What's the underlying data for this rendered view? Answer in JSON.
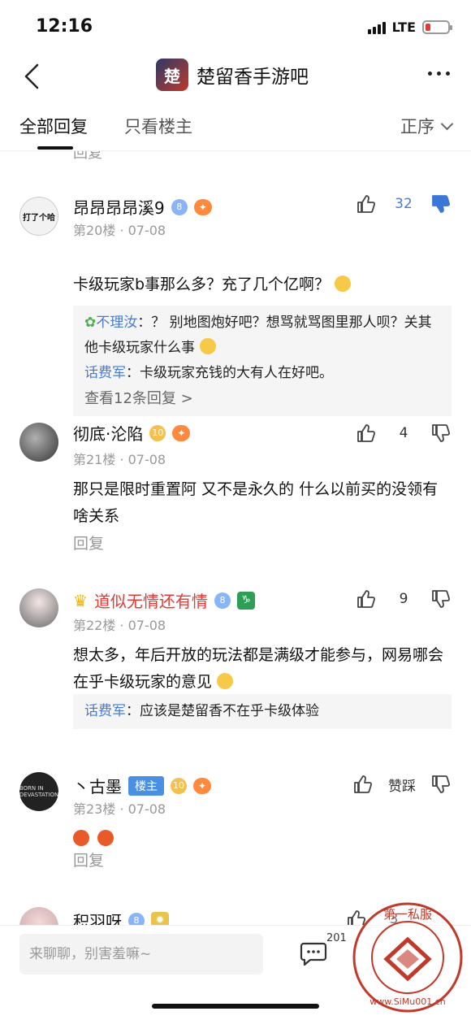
{
  "status": {
    "time": "12:16",
    "network": "LTE"
  },
  "nav": {
    "forum_name": "楚留香手游吧",
    "logo_text": "楚"
  },
  "tabs": {
    "all": "全部回复",
    "op_only": "只看楼主",
    "sort": "正序"
  },
  "prev_reply_label": "回复",
  "posts": [
    {
      "username": "昂昂昂昂溪9",
      "level": "8",
      "floor": "第20楼 · 07-08",
      "likes": "32",
      "text": "卡级玩家b事那么多？充了几个亿啊？",
      "avatar_text": "打了个哈",
      "sub_replies": [
        {
          "name": "不理汝",
          "text": "：？ 别地图炮好吧？想骂就骂图里那人呗？关其他卡级玩家什么事"
        },
        {
          "name": "话费军",
          "text": "：卡级玩家充钱的大有人在好吧。"
        }
      ],
      "more": "查看12条回复 >"
    },
    {
      "username": "彻底·沦陷",
      "level": "10",
      "floor": "第21楼 · 07-08",
      "likes": "4",
      "text": "那只是限时重置阿 又不是永久的 什么以前买的没领有啥关系",
      "reply": "回复"
    },
    {
      "username": "道似无情还有情",
      "level": "8",
      "floor": "第22楼 · 07-08",
      "likes": "9",
      "text": "想太多，年后开放的玩法都是满级才能参与，网易哪会在乎卡级玩家的意见",
      "sub_replies": [
        {
          "name": "话费军",
          "text": "：应该是楚留香不在乎卡级体验"
        }
      ]
    },
    {
      "username": "丶古墨",
      "owner_tag": "楼主",
      "level": "10",
      "floor": "第23楼 · 07-08",
      "likes": "赞踩",
      "avatar_text": "BORN IN DEVASTATION",
      "reply": "回复"
    },
    {
      "username": "积羽呀",
      "level": "8",
      "partial_like": "3"
    }
  ],
  "bottom": {
    "placeholder": "来聊聊，别害羞嘛~",
    "comment_count": "201"
  },
  "watermark": {
    "top_text": "第一私服",
    "bottom_text": "www.SiMu001.cn"
  },
  "colors": {
    "link_blue": "#4a7bd0",
    "vip_red": "#e53935",
    "owner_tag": "#4a90e2"
  }
}
